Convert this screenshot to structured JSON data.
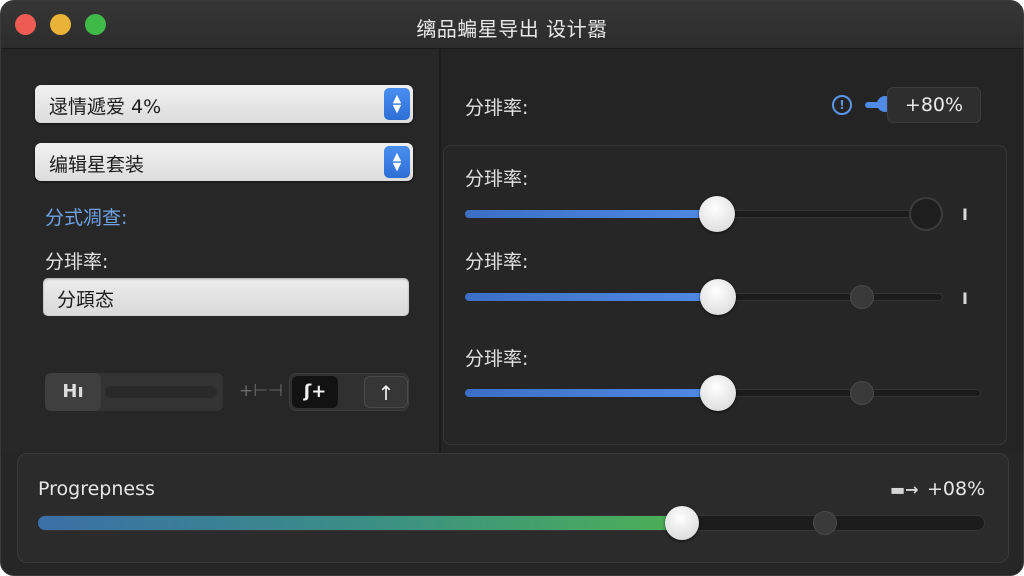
{
  "window": {
    "title": "缡品蝙星导出 设计嚣"
  },
  "left": {
    "popup1": {
      "label": "逯情遞爱 4%"
    },
    "popup2": {
      "label": "编辑星套装"
    },
    "section_label": "分式凋查:",
    "field_label": "分琲率:",
    "text_field": {
      "value": "分頙态"
    },
    "toolbar": {
      "slider_knob_label": "Hı",
      "separator": "+⊢⊣",
      "segment_a_label": "ʃ+",
      "segment_b_label": "↑"
    }
  },
  "right": {
    "header_label": "分琲率:",
    "header_value": "+80%",
    "sliders": [
      {
        "label": "分琲率:",
        "value": 0.53
      },
      {
        "label": "分琲率:",
        "value": 0.53
      },
      {
        "label": "分琲率:",
        "value": 0.49
      }
    ]
  },
  "progress": {
    "label": "Progrepness",
    "value_text": "+08%",
    "value": 0.68
  },
  "colors": {
    "accent": "#4f8ae6",
    "window_bg": "#262626",
    "section_label": "#6fa3e6",
    "progress_start": "#3a6fa6",
    "progress_end": "#4caf55"
  },
  "icons": {
    "info": "info-icon",
    "stepper": "chevron-updown-icon",
    "caret": "text-cursor-icon",
    "arrow_up": "arrow-up-icon"
  }
}
